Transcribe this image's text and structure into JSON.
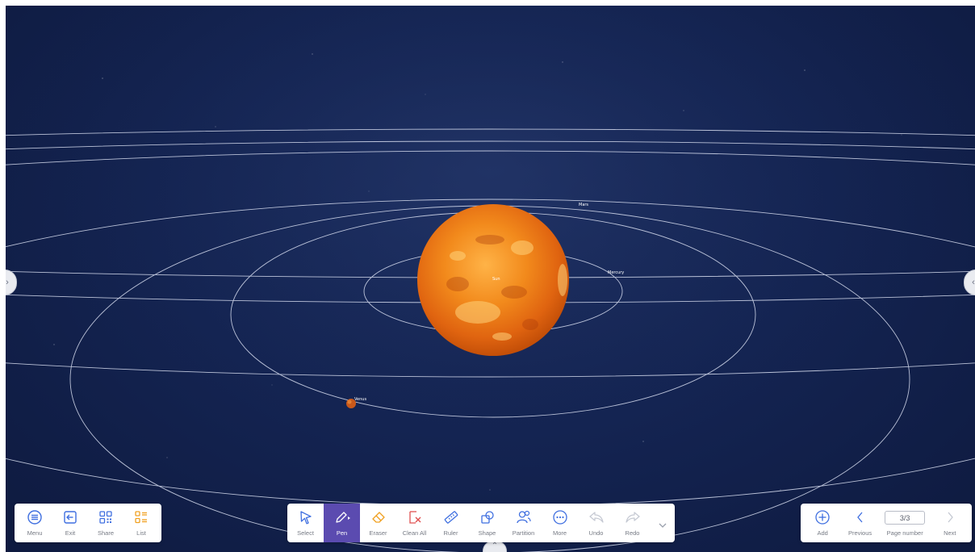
{
  "scene": {
    "sun_label": "Sun",
    "planets": [
      {
        "name": "Mercury"
      },
      {
        "name": "Venus"
      },
      {
        "name": "Mars"
      }
    ]
  },
  "left_toolbar": {
    "items": [
      {
        "label": "Menu",
        "icon": "menu-icon"
      },
      {
        "label": "Exit",
        "icon": "exit-icon"
      },
      {
        "label": "Share",
        "icon": "qr-share-icon"
      },
      {
        "label": "List",
        "icon": "list-icon"
      }
    ]
  },
  "tools_toolbar": {
    "items": [
      {
        "label": "Select",
        "icon": "select-cursor-icon"
      },
      {
        "label": "Pen",
        "icon": "pen-icon",
        "active": true
      },
      {
        "label": "Eraser",
        "icon": "eraser-icon"
      },
      {
        "label": "Clean All",
        "icon": "clean-all-icon"
      },
      {
        "label": "Ruler",
        "icon": "ruler-icon"
      },
      {
        "label": "Shape",
        "icon": "shape-icon"
      },
      {
        "label": "Partition",
        "icon": "partition-icon"
      },
      {
        "label": "More",
        "icon": "more-icon"
      },
      {
        "label": "Undo",
        "icon": "undo-icon",
        "disabled": true
      },
      {
        "label": "Redo",
        "icon": "redo-icon",
        "disabled": true
      }
    ]
  },
  "page_nav": {
    "add_label": "Add",
    "previous_label": "Previous",
    "page_value": "3/3",
    "page_number_label": "Page number",
    "next_label": "Next"
  },
  "colors": {
    "accent": "#5b4bb0",
    "icon_blue": "#3f6fe0",
    "icon_orange": "#f0a020",
    "icon_red": "#e05050",
    "icon_gray": "#c4c8d2",
    "space_bg": "#142452",
    "sun_core": "#ff9a2a"
  }
}
